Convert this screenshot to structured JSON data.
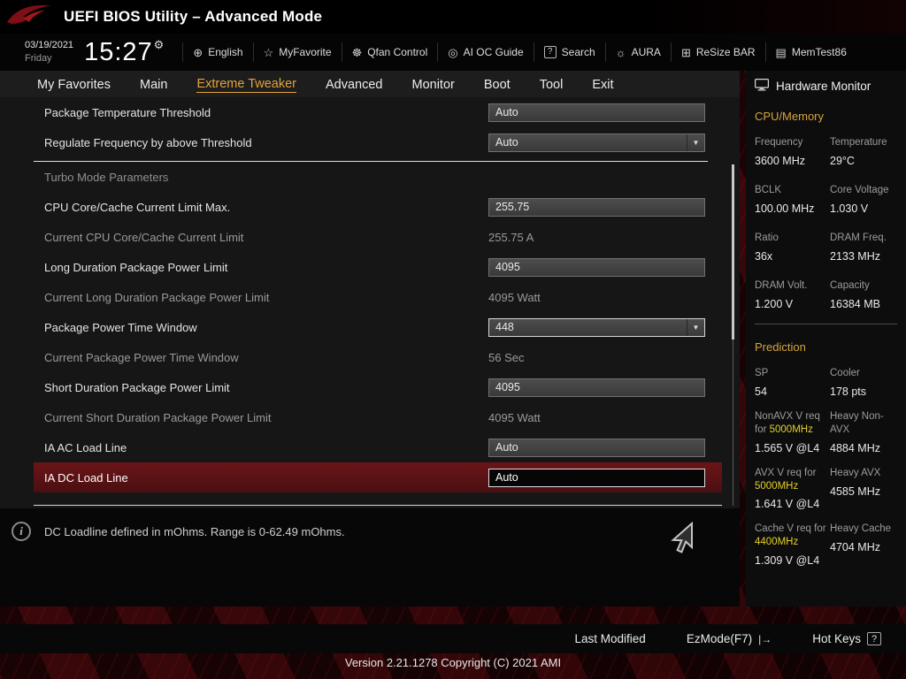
{
  "header": {
    "app_title": "UEFI BIOS Utility – Advanced Mode",
    "date": "03/19/2021",
    "day": "Friday",
    "time": "15:27",
    "clock_gear_glyph": "⚙",
    "toolbar": [
      {
        "label": "English",
        "glyph": "⊕"
      },
      {
        "label": "MyFavorite",
        "glyph": "☆"
      },
      {
        "label": "Qfan Control",
        "glyph": "☸"
      },
      {
        "label": "AI OC Guide",
        "glyph": "◎"
      },
      {
        "label": "Search",
        "glyph": "?"
      },
      {
        "label": "AURA",
        "glyph": "☼"
      },
      {
        "label": "ReSize BAR",
        "glyph": "⊞"
      },
      {
        "label": "MemTest86",
        "glyph": "▤"
      }
    ]
  },
  "nav": {
    "active_tab": "Extreme Tweaker",
    "tabs": [
      {
        "label": "My Favorites"
      },
      {
        "label": "Main"
      },
      {
        "label": "Extreme Tweaker"
      },
      {
        "label": "Advanced"
      },
      {
        "label": "Monitor"
      },
      {
        "label": "Boot"
      },
      {
        "label": "Tool"
      },
      {
        "label": "Exit"
      }
    ]
  },
  "icons": {
    "chevron_down": "▼"
  },
  "settings": {
    "section_header": "Turbo Mode Parameters",
    "rows": [
      {
        "label": "Package Temperature Threshold",
        "value": "Auto",
        "type": "input"
      },
      {
        "label": "Regulate Frequency by above Threshold",
        "value": "Auto",
        "type": "select"
      },
      {
        "label": "CPU Core/Cache Current Limit Max.",
        "value": "255.75",
        "type": "input"
      },
      {
        "label": "Current CPU Core/Cache Current Limit",
        "value": "255.75 A",
        "type": "readonly"
      },
      {
        "label": "Long Duration Package Power Limit",
        "value": "4095",
        "type": "input"
      },
      {
        "label": "Current Long Duration Package Power Limit",
        "value": "4095 Watt",
        "type": "readonly"
      },
      {
        "label": "Package Power Time Window",
        "value": "448",
        "type": "select"
      },
      {
        "label": "Current Package Power Time Window",
        "value": "56 Sec",
        "type": "readonly"
      },
      {
        "label": "Short Duration Package Power Limit",
        "value": "4095",
        "type": "input"
      },
      {
        "label": "Current Short Duration Package Power Limit",
        "value": "4095 Watt",
        "type": "readonly"
      },
      {
        "label": "IA AC Load Line",
        "value": "Auto",
        "type": "input"
      },
      {
        "label": "IA DC Load Line",
        "value": "Auto",
        "type": "input",
        "selected": true
      }
    ]
  },
  "info_panel": {
    "icon_glyph": "i",
    "text": "DC Loadline defined in mOhms. Range is 0-62.49 mOhms."
  },
  "hardware_monitor": {
    "title": "Hardware Monitor",
    "cpu_memory": {
      "title": "CPU/Memory",
      "stats": [
        {
          "label": "Frequency",
          "value": "3600 MHz"
        },
        {
          "label": "Temperature",
          "value": "29°C"
        },
        {
          "label": "BCLK",
          "value": "100.00 MHz"
        },
        {
          "label": "Core Voltage",
          "value": "1.030 V"
        },
        {
          "label": "Ratio",
          "value": "36x"
        },
        {
          "label": "DRAM Freq.",
          "value": "2133 MHz"
        },
        {
          "label": "DRAM Volt.",
          "value": "1.200 V"
        },
        {
          "label": "Capacity",
          "value": "16384 MB"
        }
      ]
    },
    "prediction": {
      "title": "Prediction",
      "stats": [
        {
          "label": "SP",
          "value": "54"
        },
        {
          "label": "Cooler",
          "value": "178 pts"
        },
        {
          "label_prefix": "NonAVX V req for ",
          "label_highlight": "5000MHz",
          "value": "1.565 V @L4"
        },
        {
          "label": "Heavy Non-AVX",
          "value": "4884 MHz"
        },
        {
          "label_prefix": "AVX V req for ",
          "label_highlight": "5000MHz",
          "value": "1.641 V @L4"
        },
        {
          "label": "Heavy AVX",
          "value": "4585 MHz"
        },
        {
          "label_prefix": "Cache V req for ",
          "label_highlight": "4400MHz",
          "value": "1.309 V @L4"
        },
        {
          "label": "Heavy Cache",
          "value": "4704 MHz"
        }
      ]
    }
  },
  "footer": {
    "last_modified": "Last Modified",
    "ez_mode": "EzMode(F7)",
    "ez_mode_icon": "|→",
    "hot_keys": "Hot Keys",
    "hot_keys_icon": "?",
    "version": "Version 2.21.1278 Copyright (C) 2021 AMI"
  },
  "colors": {
    "accent_orange": "#e2a33c",
    "highlight_yellow": "#e3cf2a",
    "selected_row_red": "#5f1315"
  }
}
